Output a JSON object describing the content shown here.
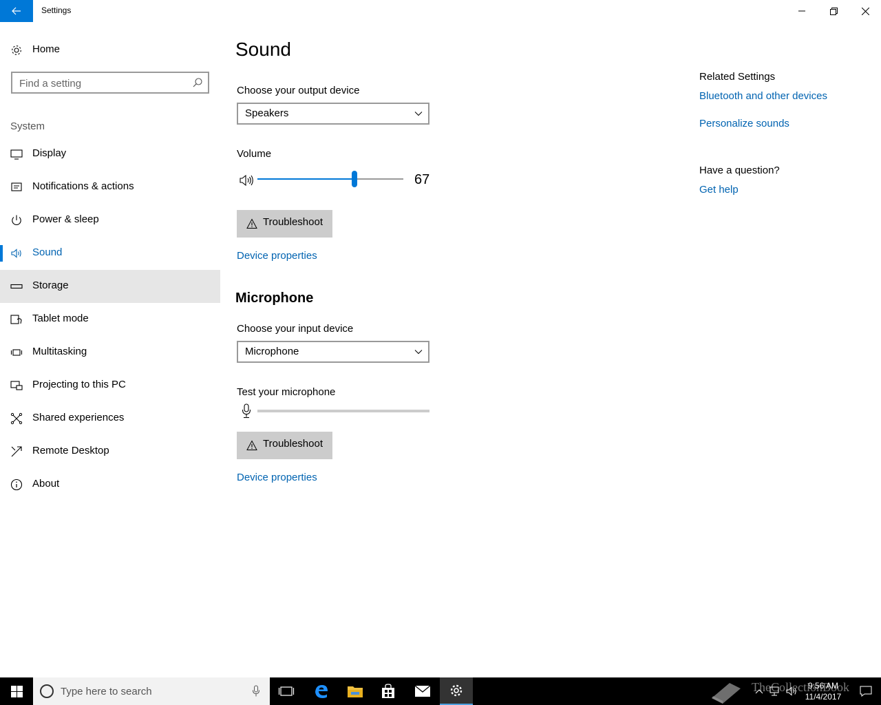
{
  "window": {
    "title": "Settings"
  },
  "sidebar": {
    "home_label": "Home",
    "search_placeholder": "Find a setting",
    "group_label": "System",
    "items": [
      {
        "label": "Display",
        "icon": "display-icon"
      },
      {
        "label": "Notifications & actions",
        "icon": "notifications-icon"
      },
      {
        "label": "Power & sleep",
        "icon": "power-icon"
      },
      {
        "label": "Sound",
        "icon": "speaker-icon",
        "selected": true
      },
      {
        "label": "Storage",
        "icon": "storage-icon",
        "hover": true
      },
      {
        "label": "Tablet mode",
        "icon": "tablet-mode-icon"
      },
      {
        "label": "Multitasking",
        "icon": "multitasking-icon"
      },
      {
        "label": "Projecting to this PC",
        "icon": "projecting-icon"
      },
      {
        "label": "Shared experiences",
        "icon": "shared-experiences-icon"
      },
      {
        "label": "Remote Desktop",
        "icon": "remote-desktop-icon"
      },
      {
        "label": "About",
        "icon": "info-icon"
      }
    ]
  },
  "main": {
    "title": "Sound",
    "output": {
      "label": "Choose your output device",
      "value": "Speakers",
      "volume_label": "Volume",
      "volume_value": "67",
      "volume_fraction": 0.67,
      "troubleshoot_label": "Troubleshoot",
      "device_properties_label": "Device properties"
    },
    "microphone": {
      "section_title": "Microphone",
      "label": "Choose your input device",
      "value": "Microphone",
      "test_label": "Test your microphone",
      "test_level": 0,
      "troubleshoot_label": "Troubleshoot",
      "device_properties_label": "Device properties"
    }
  },
  "related": {
    "heading": "Related Settings",
    "links": [
      "Bluetooth and other devices",
      "Personalize sounds"
    ],
    "question_heading": "Have a question?",
    "help_link": "Get help"
  },
  "taskbar": {
    "search_placeholder": "Type here to search",
    "time": "9:56 AM",
    "date": "11/4/2017",
    "watermark_text": "TheCollectionBook"
  },
  "colors": {
    "accent": "#0078d7",
    "link": "#0063b1",
    "sidebar_hover": "#e6e6e6",
    "button_bg": "#cccccc",
    "taskbar_bg": "#000000"
  }
}
